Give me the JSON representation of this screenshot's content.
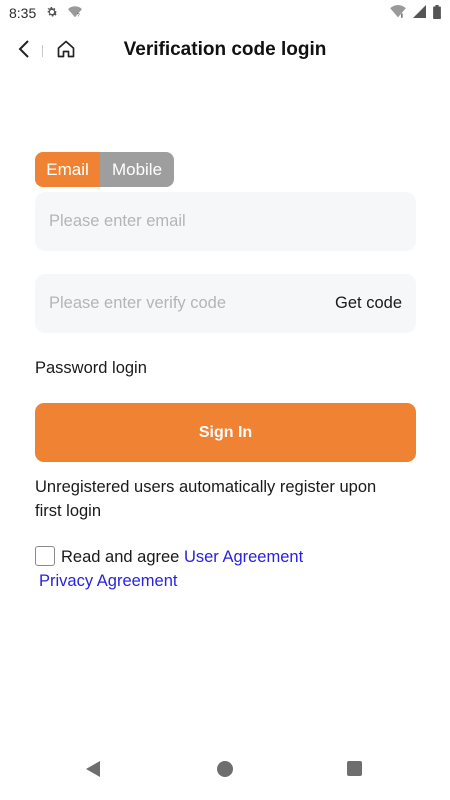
{
  "status_bar": {
    "time": "8:35",
    "icons_left": [
      "gear-icon",
      "wifi-question-icon"
    ],
    "icons_right": [
      "wifi-icon",
      "cellular-icon",
      "battery-icon"
    ]
  },
  "header": {
    "title": "Verification code login",
    "back_icon": "chevron-left-icon",
    "home_icon": "home-icon"
  },
  "tabs": [
    {
      "label": "Email",
      "active": true
    },
    {
      "label": "Mobile",
      "active": false
    }
  ],
  "email_field": {
    "placeholder": "Please enter email",
    "value": ""
  },
  "code_field": {
    "placeholder": "Please enter verify code",
    "value": "",
    "action_label": "Get code"
  },
  "password_login_label": "Password login",
  "signin_label": "Sign In",
  "notice": "Unregistered users automatically register upon first login",
  "agreement": {
    "prefix": "Read and agree ",
    "user_agreement": "User Agreement",
    "privacy_agreement": "Privacy Agreement",
    "checked": false
  },
  "colors": {
    "accent": "#f08233",
    "tab_inactive": "#9e9e9e",
    "link": "#2a22e0",
    "field_bg": "#f6f7f9"
  }
}
